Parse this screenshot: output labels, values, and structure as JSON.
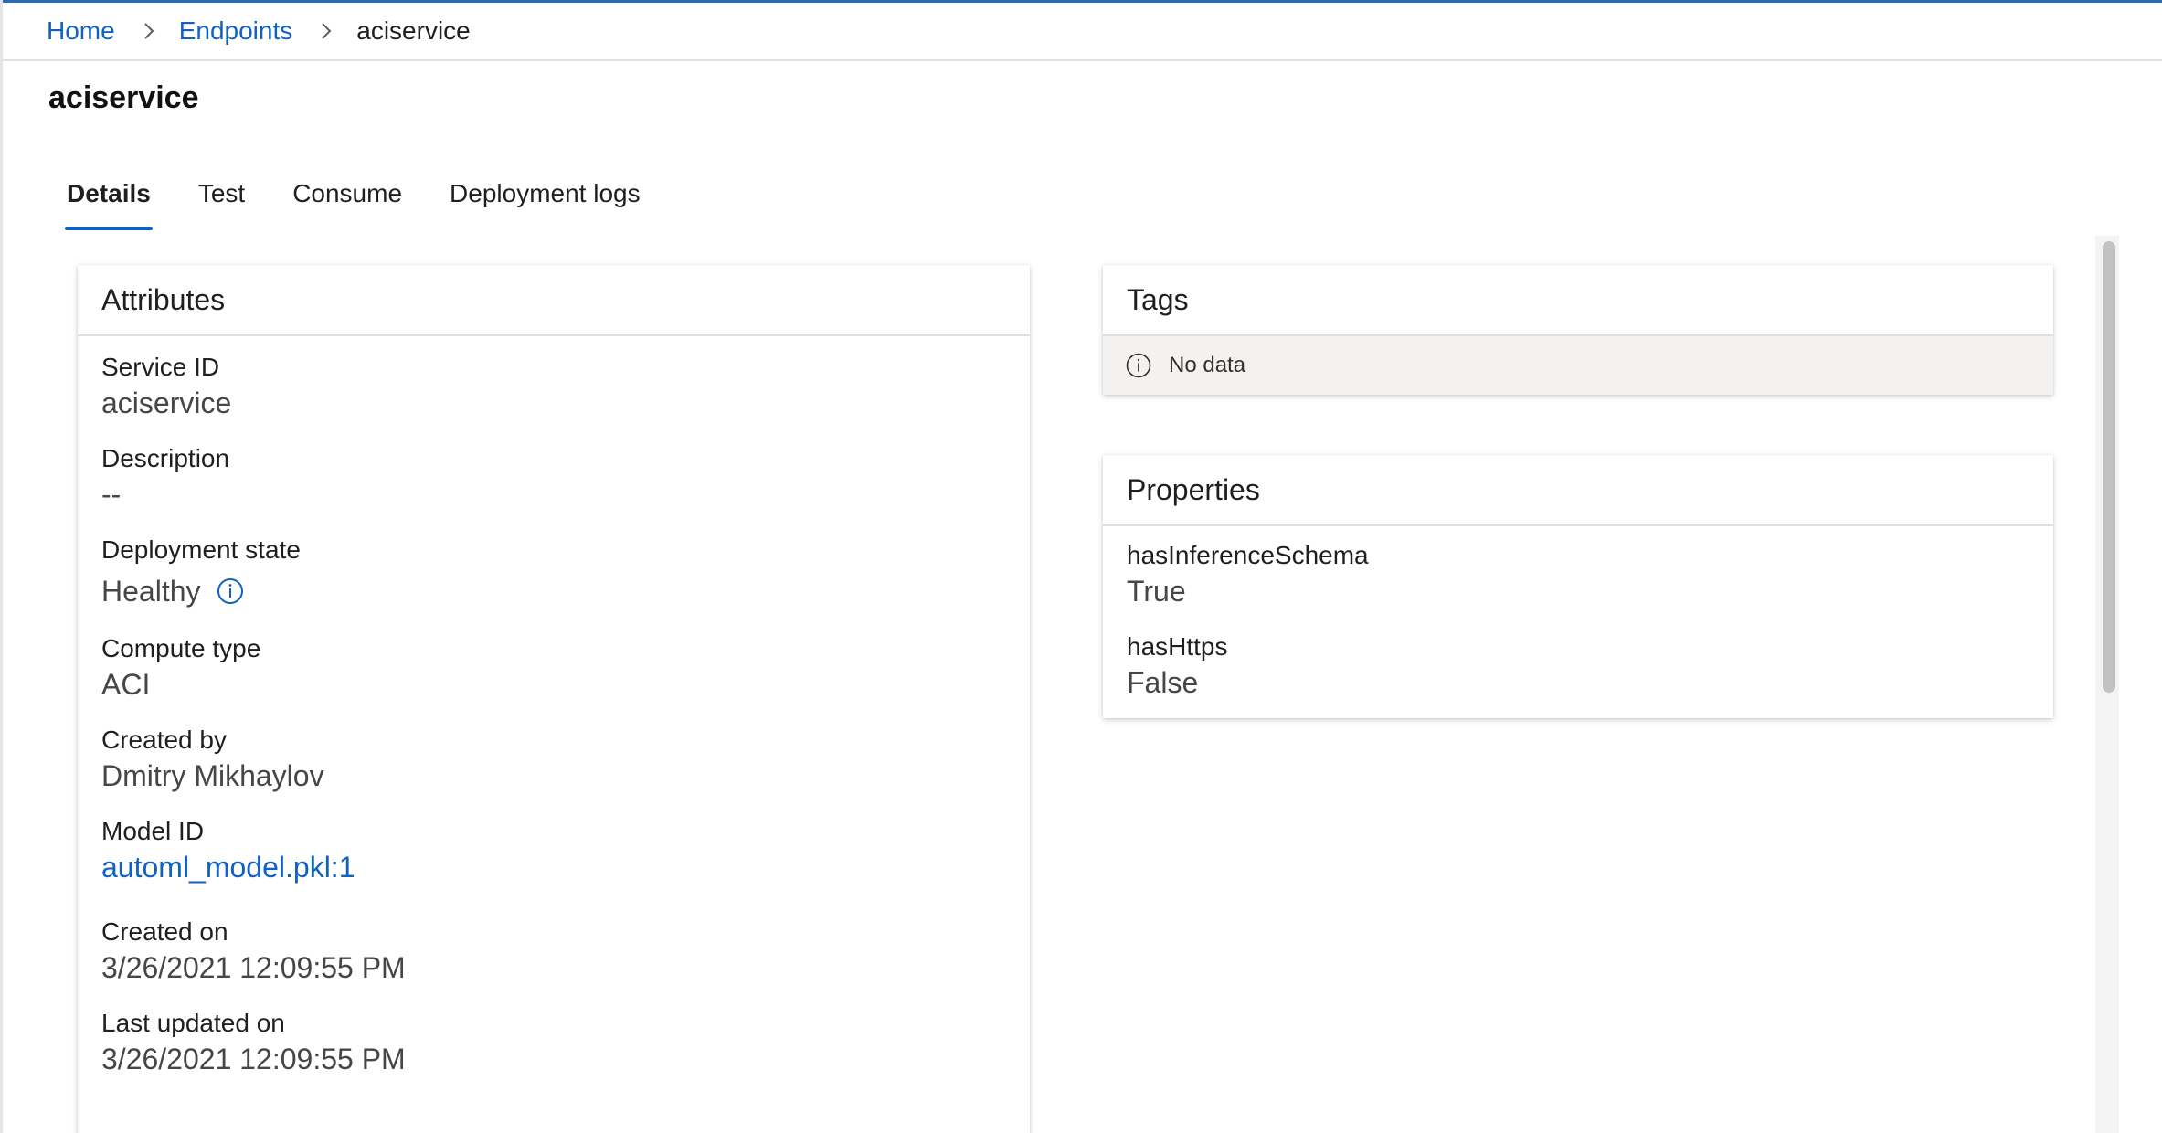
{
  "breadcrumb": {
    "items": [
      {
        "label": "Home"
      },
      {
        "label": "Endpoints"
      },
      {
        "label": "aciservice"
      }
    ]
  },
  "page": {
    "title": "aciservice"
  },
  "tabs": [
    {
      "label": "Details",
      "active": true
    },
    {
      "label": "Test"
    },
    {
      "label": "Consume"
    },
    {
      "label": "Deployment logs"
    }
  ],
  "attributes": {
    "title": "Attributes",
    "fields": [
      {
        "label": "Service ID",
        "value": "aciservice"
      },
      {
        "label": "Description",
        "value": "--"
      },
      {
        "label": "Deployment state",
        "value": "Healthy",
        "icon": "info-icon"
      },
      {
        "label": "Compute type",
        "value": "ACI"
      },
      {
        "label": "Created by",
        "value": "Dmitry Mikhaylov"
      },
      {
        "label": "Model ID",
        "value": "automl_model.pkl:1",
        "link": true
      },
      {
        "label": "Created on",
        "value": "3/26/2021 12:09:55 PM"
      },
      {
        "label": "Last updated on",
        "value": "3/26/2021 12:09:55 PM"
      }
    ]
  },
  "tags": {
    "title": "Tags",
    "empty_text": "No data",
    "icon": "info-icon"
  },
  "properties": {
    "title": "Properties",
    "fields": [
      {
        "label": "hasInferenceSchema",
        "value": "True"
      },
      {
        "label": "hasHttps",
        "value": "False"
      }
    ]
  },
  "colors": {
    "accent": "#0f62c4",
    "text": "#201f1e",
    "value_text": "#484644",
    "nodata_bg": "#f3f2f1"
  }
}
